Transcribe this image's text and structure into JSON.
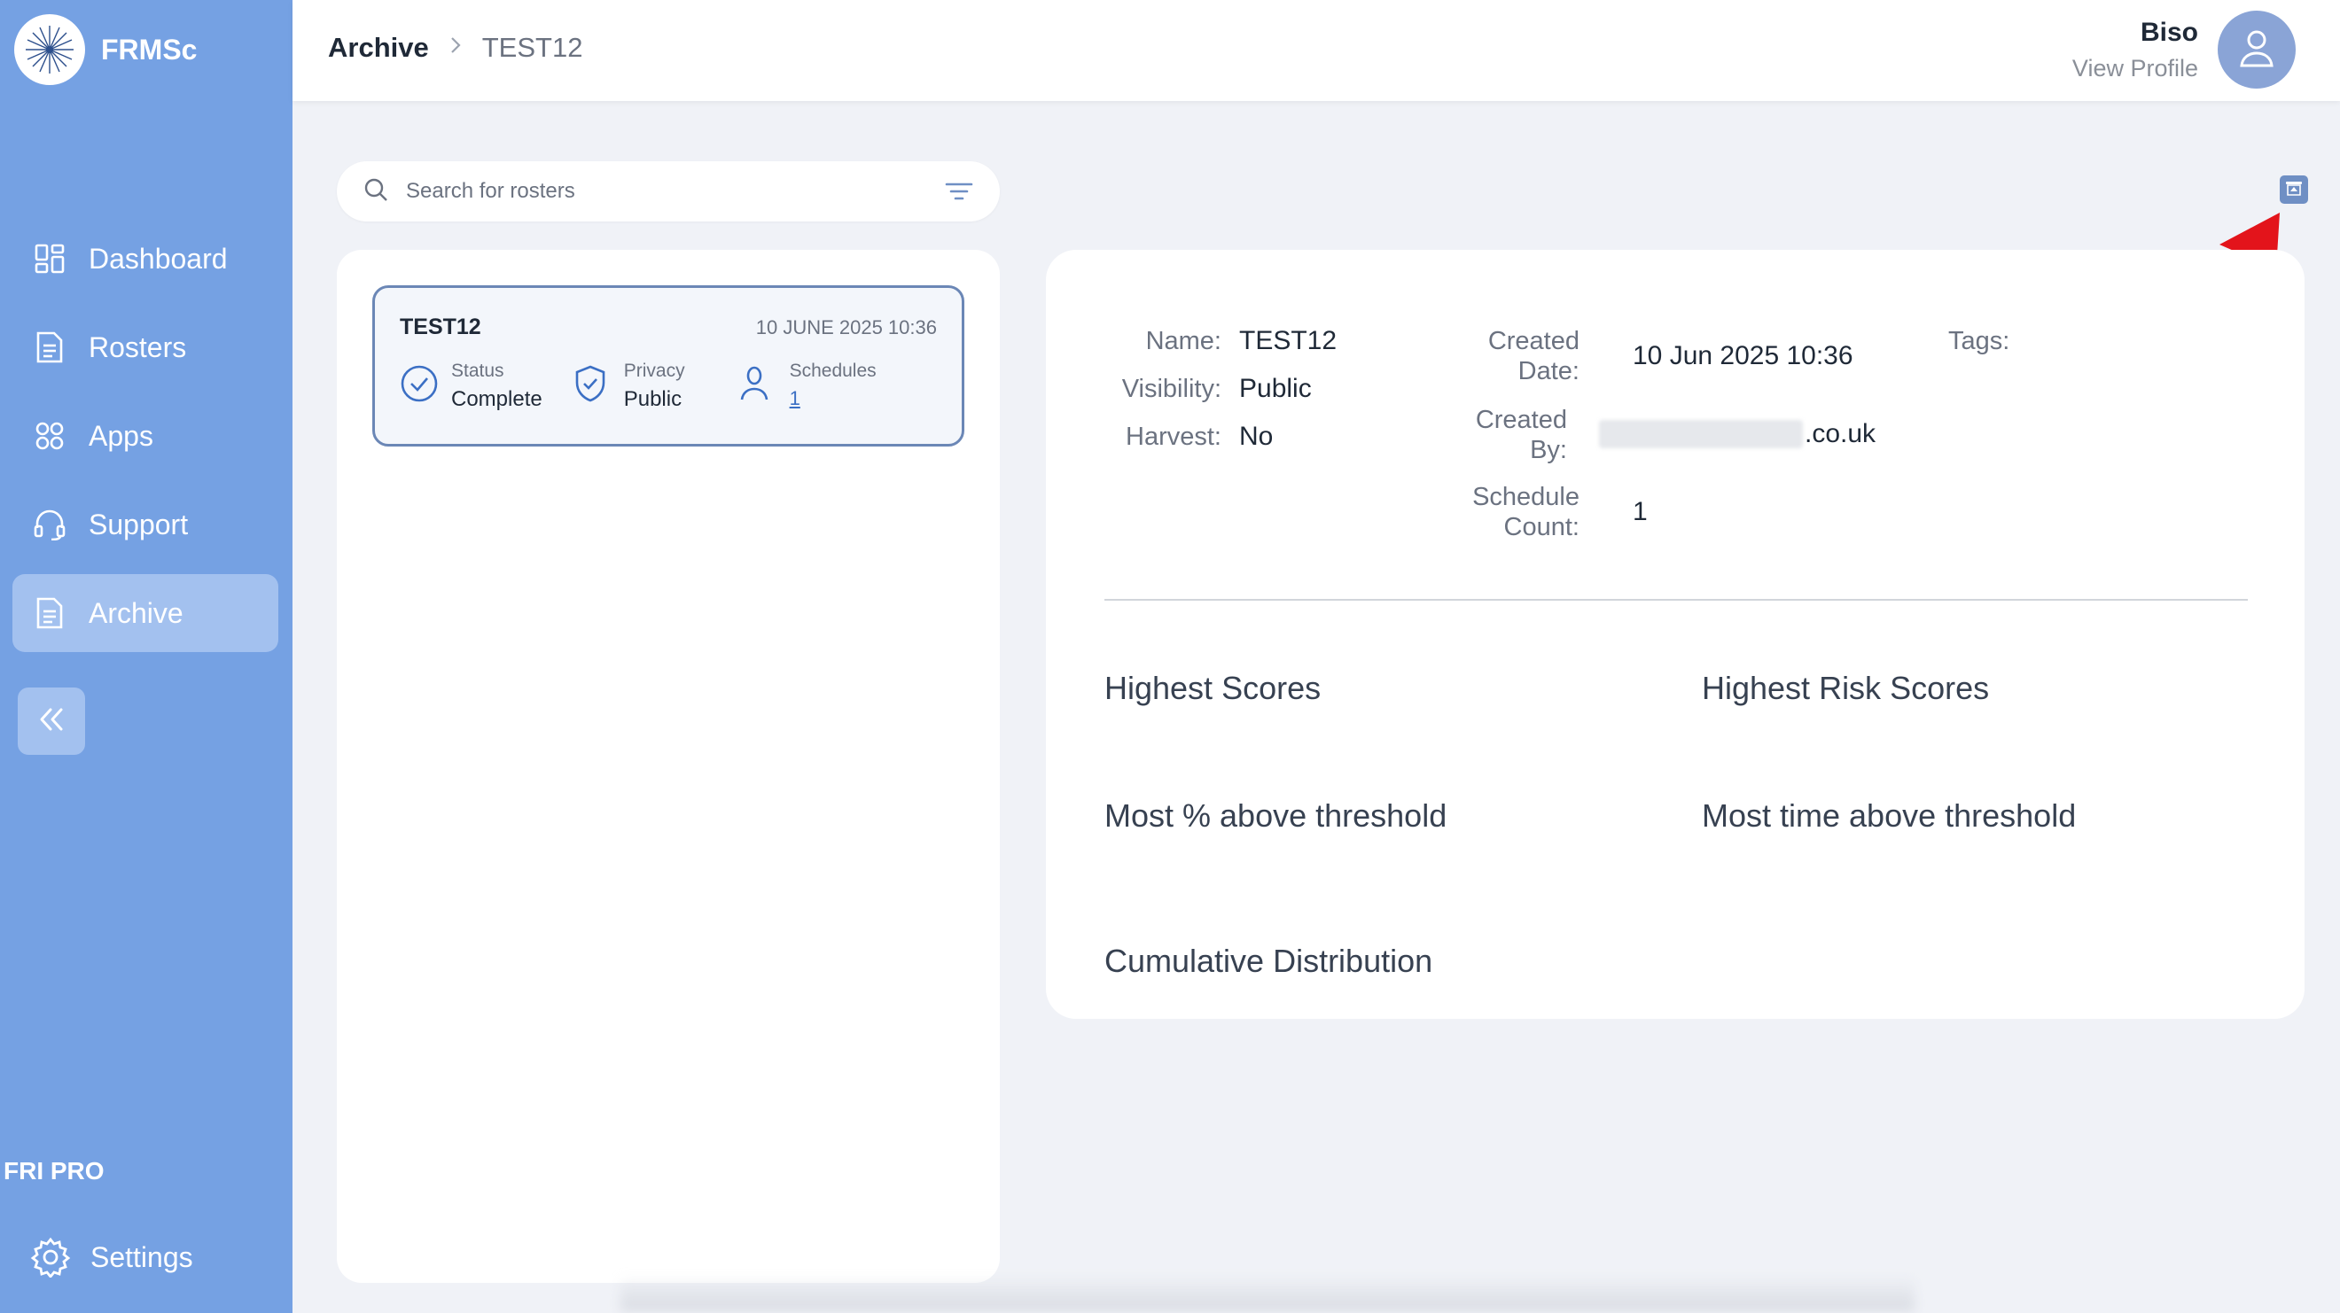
{
  "brand": {
    "name": "FRMSc",
    "logo_icon": "starburst-logo"
  },
  "sidebar": {
    "items": [
      {
        "label": "Dashboard",
        "icon": "dashboard-icon",
        "active": false
      },
      {
        "label": "Rosters",
        "icon": "document-icon",
        "active": false
      },
      {
        "label": "Apps",
        "icon": "apps-icon",
        "active": false
      },
      {
        "label": "Support",
        "icon": "headset-icon",
        "active": false
      },
      {
        "label": "Archive",
        "icon": "document-icon",
        "active": true
      }
    ],
    "plan": "FRI PRO",
    "settings_label": "Settings"
  },
  "header": {
    "breadcrumb": {
      "root": "Archive",
      "current": "TEST12"
    },
    "user": {
      "name": "Biso",
      "profile_link": "View Profile"
    }
  },
  "search": {
    "placeholder": "Search for rosters"
  },
  "roster_card": {
    "title": "TEST12",
    "date": "10 JUNE 2025 10:36",
    "status_label": "Status",
    "status_value": "Complete",
    "privacy_label": "Privacy",
    "privacy_value": "Public",
    "schedules_label": "Schedules",
    "schedules_value": "1"
  },
  "details": {
    "name_label": "Name:",
    "name_value": "TEST12",
    "visibility_label": "Visibility:",
    "visibility_value": "Public",
    "harvest_label": "Harvest:",
    "harvest_value": "No",
    "created_date_label_1": "Created",
    "created_date_label_2": "Date:",
    "created_date_value": "10 Jun 2025 10:36",
    "created_by_label_1": "Created",
    "created_by_label_2": "By:",
    "created_by_value": ".co.uk",
    "schedule_count_label_1": "Schedule",
    "schedule_count_label_2": "Count:",
    "schedule_count_value": "1",
    "tags_label": "Tags:"
  },
  "sections": {
    "highest_scores": "Highest Scores",
    "highest_risk_scores": "Highest Risk Scores",
    "most_pct_above": "Most % above threshold",
    "most_time_above": "Most time above threshold",
    "cumulative": "Cumulative Distribution"
  },
  "colors": {
    "sidebar": "#75a1e3",
    "sidebar_active": "#a3c1ef",
    "accent": "#3b6fc4",
    "annotation_arrow": "#e3141b"
  }
}
